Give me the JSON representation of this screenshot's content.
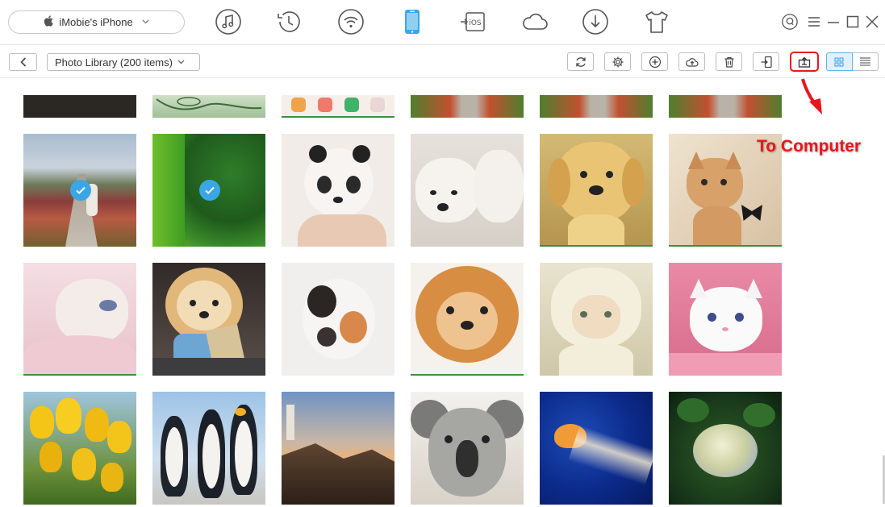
{
  "device": {
    "name": "iMobie's iPhone",
    "apple_icon": "apple-icon",
    "chevron": "chevron-down-icon"
  },
  "nav": [
    {
      "name": "music-icon",
      "active": false
    },
    {
      "name": "history-icon",
      "active": false
    },
    {
      "name": "wifi-transfer-icon",
      "active": false
    },
    {
      "name": "phone-icon",
      "active": true
    },
    {
      "name": "ios-transfer-icon",
      "label": "iOS",
      "active": false
    },
    {
      "name": "cloud-icon",
      "active": false
    },
    {
      "name": "download-icon",
      "active": false
    },
    {
      "name": "tshirt-icon",
      "active": false
    }
  ],
  "window_controls": [
    "help-icon",
    "menu-icon",
    "minimize-icon",
    "maximize-icon",
    "close-icon"
  ],
  "toolbar": {
    "library_label": "Photo Library (200 items)",
    "buttons": [
      "refresh-icon",
      "settings-icon",
      "add-icon",
      "upload-cloud-icon",
      "delete-icon",
      "export-to-device-icon",
      "to-computer-icon"
    ],
    "view_modes": [
      "grid-view-icon",
      "list-view-icon"
    ],
    "active_view": "grid"
  },
  "annotation": {
    "text": "To Computer"
  },
  "colors": {
    "accent": "#3aa6e6",
    "annotation": "#e8161c",
    "selection_border": "#3aa6e6"
  },
  "photos": {
    "partial_row": [
      {
        "subject": "dark-photo"
      },
      {
        "subject": "sketch-photo"
      },
      {
        "subject": "app-icons-screenshot"
      },
      {
        "subject": "boardwalk-flowers"
      },
      {
        "subject": "boardwalk-flowers"
      },
      {
        "subject": "boardwalk-flowers"
      }
    ],
    "rows": [
      [
        {
          "subject": "girl-boardwalk",
          "selected": true
        },
        {
          "subject": "green-leaves",
          "selected": true
        },
        {
          "subject": "panda-puppy",
          "selected": false
        },
        {
          "subject": "white-puppies",
          "selected": false
        },
        {
          "subject": "golden-puppy",
          "selected": false
        },
        {
          "subject": "kitten-butterfly",
          "selected": false
        }
      ],
      [
        {
          "subject": "sleeping-kitten",
          "selected": false
        },
        {
          "subject": "pomeranian-sweater",
          "selected": false
        },
        {
          "subject": "curled-kitten",
          "selected": false
        },
        {
          "subject": "pomeranian-face",
          "selected": false
        },
        {
          "subject": "kitten-hood",
          "selected": false
        },
        {
          "subject": "white-kitten",
          "selected": false
        }
      ],
      [
        {
          "subject": "yellow-tulips",
          "selected": false
        },
        {
          "subject": "penguins",
          "selected": false
        },
        {
          "subject": "lighthouse",
          "selected": false
        },
        {
          "subject": "koala",
          "selected": false
        },
        {
          "subject": "jellyfish",
          "selected": false
        },
        {
          "subject": "hydrangea",
          "selected": false
        }
      ]
    ]
  }
}
